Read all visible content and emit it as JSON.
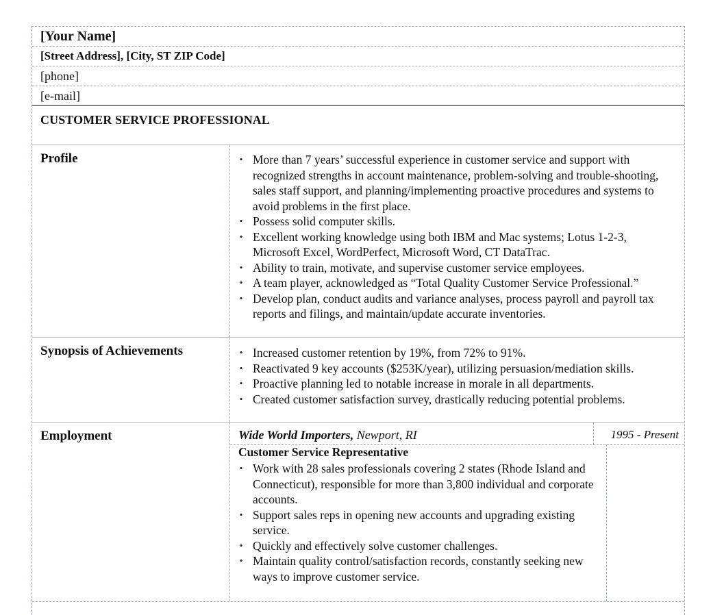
{
  "header": {
    "name": "[Your Name]",
    "address": "[Street Address], [City, ST  ZIP Code]",
    "phone": "[phone]",
    "email": "[e-mail]"
  },
  "title": "CUSTOMER SERVICE PROFESSIONAL",
  "sections": {
    "profile": {
      "label": "Profile",
      "bullets": [
        "More than 7 years’ successful experience in customer service and support with recognized strengths in account maintenance, problem-solving and trouble-shooting, sales staff support, and planning/implementing proactive procedures and systems to avoid problems in the first place.",
        "Possess solid computer skills.",
        "Excellent working knowledge using both IBM and Mac systems; Lotus 1-2-3, Microsoft Excel, WordPerfect, Microsoft Word, CT DataTrac.",
        "Ability to train, motivate, and supervise customer service employees.",
        "A team player, acknowledged as “Total Quality Customer Service Professional.”",
        "Develop plan, conduct audits and variance analyses, process payroll and payroll tax reports and filings, and maintain/update accurate inventories."
      ]
    },
    "synopsis": {
      "label": "Synopsis of Achievements",
      "bullets": [
        "Increased customer retention by 19%, from 72% to 91%.",
        "Reactivated 9 key accounts ($253K/year), utilizing persuasion/mediation skills.",
        "Proactive planning led to notable increase in morale in all departments.",
        "Created customer satisfaction survey, drastically reducing potential problems."
      ]
    },
    "employment": {
      "label": "Employment",
      "company": "Wide World Importers,",
      "location": " Newport, RI",
      "dates": "1995 - Present",
      "role": "Customer Service Representative",
      "bullets": [
        "Work with 28 sales professionals covering 2 states (Rhode Island and Connecticut), responsible for more than 3,800 individual and corporate accounts.",
        "Support sales reps in opening new accounts and upgrading existing service.",
        "Quickly and effectively solve customer challenges.",
        "Maintain quality control/satisfaction records, constantly seeking new ways to improve customer service."
      ]
    }
  },
  "bullet_glyph": "•"
}
